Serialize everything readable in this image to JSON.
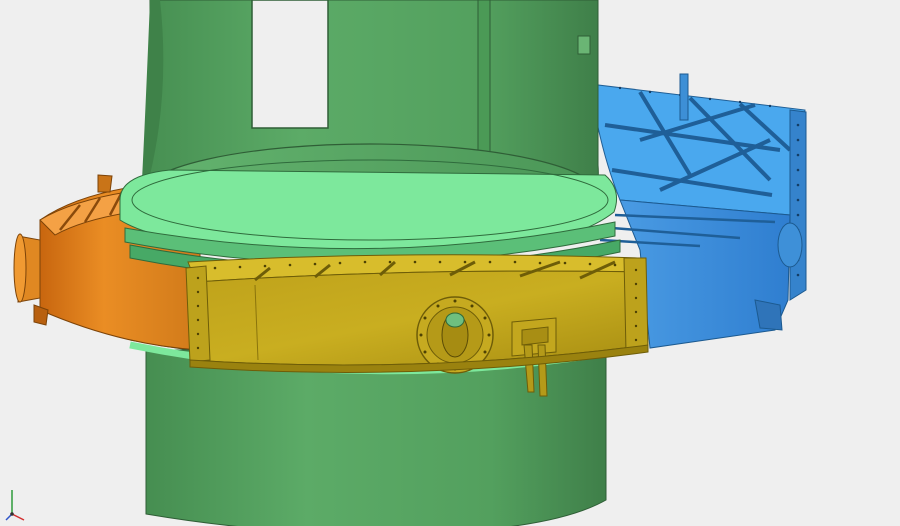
{
  "viewport": {
    "background": "#efefef"
  },
  "model": {
    "parts": [
      {
        "name": "column-shell",
        "color": "#5ca866"
      },
      {
        "name": "ring-flange",
        "color": "#7de89c"
      },
      {
        "name": "left-ring-segment",
        "color": "#e38a21"
      },
      {
        "name": "front-ring-segment",
        "color": "#c9ae1c"
      },
      {
        "name": "right-ring-segment",
        "color": "#3a8fd8"
      },
      {
        "name": "right-ring-top",
        "color": "#4aa8ee"
      }
    ]
  },
  "triad": {
    "axes": [
      "x",
      "y",
      "z"
    ],
    "colors": {
      "x": "#d32f2f",
      "y": "#2e9b3a",
      "z": "#2f55c9"
    },
    "icon": "axis-triad-icon"
  }
}
